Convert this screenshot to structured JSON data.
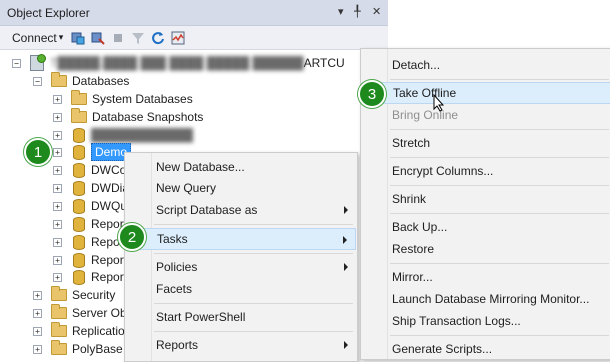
{
  "panel": {
    "title": "Object Explorer",
    "title_controls": [
      "▾",
      "╀",
      "✕"
    ],
    "connect_label": "Connect",
    "connect_arrow": "▾"
  },
  "tree": {
    "server_suffix": "ARTCU",
    "databases": "Databases",
    "system_databases": "System Databases",
    "database_snapshots": "Database Snapshots",
    "demo_label": "Demo",
    "items": [
      "DWCo",
      "DWDia",
      "DWQu",
      "Report",
      "Report",
      "Report",
      "Report"
    ],
    "security": "Security",
    "server_objects": "Server Obj",
    "replication": "Replication",
    "polybase": "PolyBase"
  },
  "context_menu": {
    "items": [
      {
        "label": "New Database..."
      },
      {
        "label": "New Query"
      },
      {
        "label": "Script Database as"
      },
      {
        "label": "Tasks"
      },
      {
        "label": "Policies"
      },
      {
        "label": "Facets"
      },
      {
        "label": "Start PowerShell"
      },
      {
        "label": "Reports"
      }
    ]
  },
  "tasks_menu": {
    "items": [
      {
        "label": "Detach..."
      },
      {
        "label": "Take Offline"
      },
      {
        "label": "Bring Online"
      },
      {
        "label": "Stretch"
      },
      {
        "label": "Encrypt Columns..."
      },
      {
        "label": "Shrink"
      },
      {
        "label": "Back Up..."
      },
      {
        "label": "Restore"
      },
      {
        "label": "Mirror..."
      },
      {
        "label": "Launch Database Mirroring Monitor..."
      },
      {
        "label": "Ship Transaction Logs..."
      },
      {
        "label": "Generate Scripts..."
      }
    ]
  },
  "badges": {
    "one": "1",
    "two": "2",
    "three": "3"
  },
  "colors": {
    "badge": "#1e8a1e",
    "selection": "#3399ff",
    "highlight": "#dceefc"
  }
}
